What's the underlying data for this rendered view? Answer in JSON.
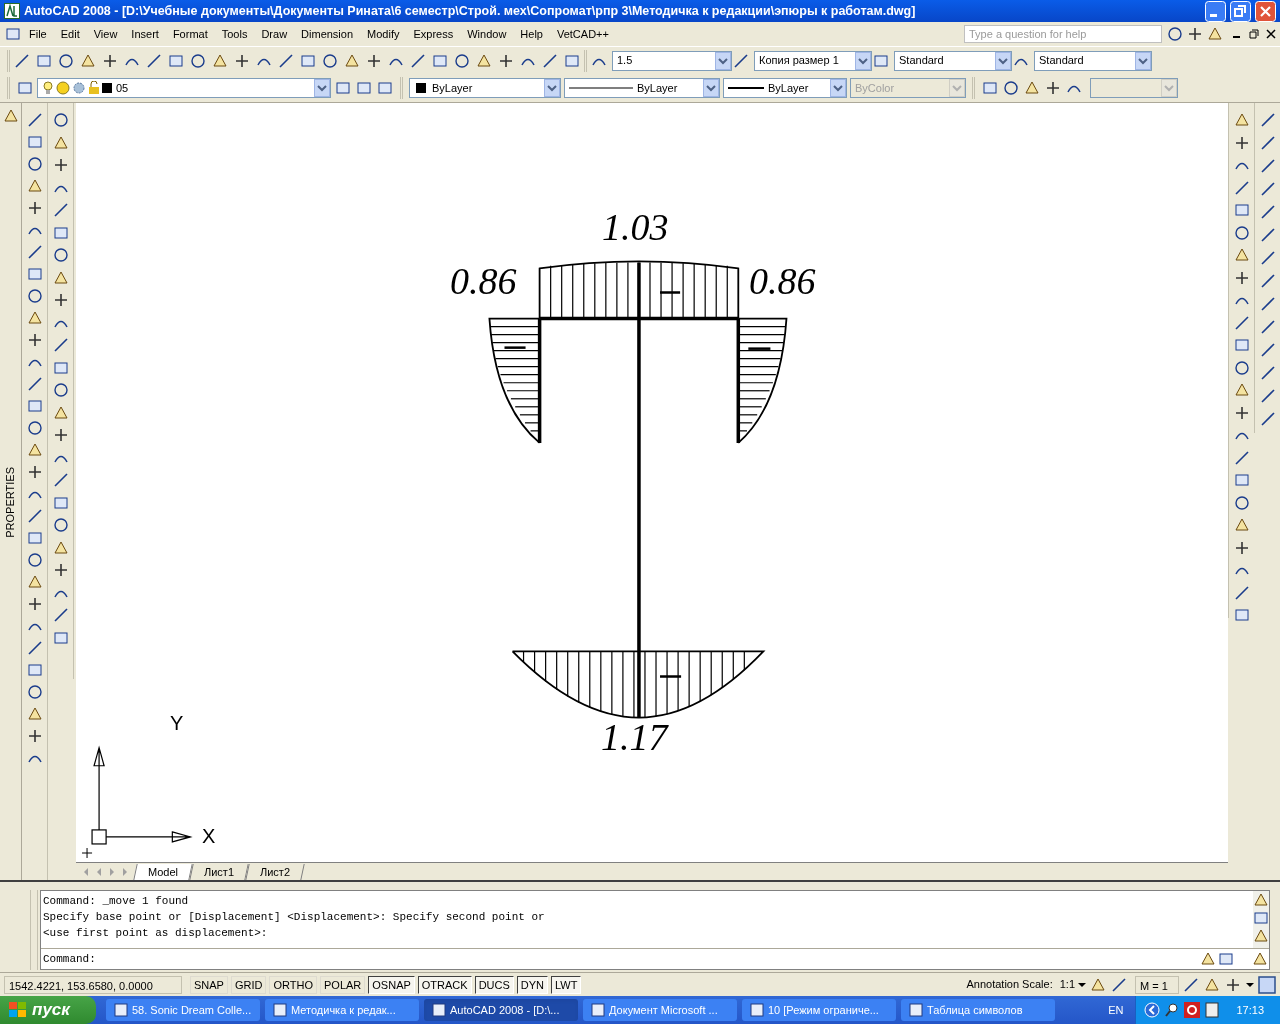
{
  "window": {
    "title": "AutoCAD 2008 - [D:\\Учебные документы\\Документы Рината\\6 семестр\\Строй. мех\\Сопромат\\рпр 3\\Методичка к редакции\\эпюры к работам.dwg]"
  },
  "menu": [
    "File",
    "Edit",
    "View",
    "Insert",
    "Format",
    "Tools",
    "Draw",
    "Dimension",
    "Modify",
    "Express",
    "Window",
    "Help",
    "VetCAD++"
  ],
  "help_search": {
    "placeholder": "Type a question for help"
  },
  "style_fields": [
    {
      "value": "1.5"
    },
    {
      "value": "Копия размер 1"
    },
    {
      "value": "Standard"
    },
    {
      "value": "Standard"
    }
  ],
  "layer_field": {
    "value": "05"
  },
  "property_fields": [
    {
      "value": "ByLayer",
      "kind": "color",
      "disabled": false
    },
    {
      "value": "ByLayer",
      "kind": "linetype",
      "disabled": false
    },
    {
      "value": "ByLayer",
      "kind": "lineweight",
      "disabled": false
    },
    {
      "value": "ByColor",
      "kind": "plain",
      "disabled": true
    }
  ],
  "palette": {
    "label": "PROPERTIES"
  },
  "drawing": {
    "labels": [
      {
        "text": "1.03"
      },
      {
        "text": "0.86"
      },
      {
        "text": "0.86"
      },
      {
        "text": "1.17"
      }
    ],
    "ucs": {
      "y": "Y",
      "x": "X"
    }
  },
  "layout_tabs": [
    {
      "label": "Model",
      "selected": true
    },
    {
      "label": "Лист1",
      "selected": false
    },
    {
      "label": "Лист2",
      "selected": false
    }
  ],
  "command_history": [
    "Command: _move 1 found",
    "Specify base point or [Displacement] <Displacement>: Specify second point or",
    "<use first point as displacement>:"
  ],
  "command_prompt": "Command:",
  "status_bar": {
    "coordinates": "1542.4221, 153.6580, 0.0000",
    "toggles": [
      {
        "label": "SNAP",
        "on": false
      },
      {
        "label": "GRID",
        "on": false
      },
      {
        "label": "ORTHO",
        "on": false
      },
      {
        "label": "POLAR",
        "on": false
      },
      {
        "label": "OSNAP",
        "on": true
      },
      {
        "label": "OTRACK",
        "on": true
      },
      {
        "label": "DUCS",
        "on": true
      },
      {
        "label": "DYN",
        "on": true
      },
      {
        "label": "LWT",
        "on": true
      }
    ],
    "annotation_label": "Annotation Scale:",
    "annotation_scale": "1:1",
    "m_value": "M = 1"
  },
  "taskbar": {
    "start": "пуск",
    "tasks": [
      {
        "label": "58. Sonic Dream Colle...",
        "selected": false
      },
      {
        "label": "Методичка к редак...",
        "selected": false
      },
      {
        "label": "AutoCAD 2008 - [D:\\...",
        "selected": true
      },
      {
        "label": "Документ Microsoft ...",
        "selected": false
      },
      {
        "label": "10 [Режим ограниче...",
        "selected": false
      },
      {
        "label": "Таблица символов",
        "selected": false
      }
    ],
    "language": "EN",
    "clock": "17:13"
  }
}
